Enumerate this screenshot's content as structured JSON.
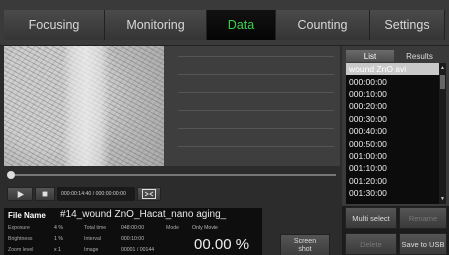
{
  "tabs": [
    "Focusing",
    "Monitoring",
    "Data",
    "Counting",
    "Settings"
  ],
  "player": {
    "timecode": "000:00:14:40 / 000:00:00:00",
    "progress_fraction": 0.0
  },
  "file_info": {
    "file_name_label": "File Name",
    "file_name": "#14_wound ZnO_Hacat_nano aging_",
    "exposure_label": "Exposure",
    "exposure_value": "4 %",
    "brightness_label": "Brightness",
    "brightness_value": "1 %",
    "zoom_label": "Zoom level",
    "zoom_value": "x 1",
    "total_time_label": "Total time",
    "total_time_value": "048:00:00",
    "interval_label": "Interval",
    "interval_value": "000:10:00",
    "image_label": "Image",
    "image_value": "00001 / 00144",
    "mode_label": "Mode",
    "mode_value": "Only Movie",
    "percent": "00.00 %"
  },
  "screenshot_button": {
    "line1": "Screen",
    "line2": "shot"
  },
  "right_panel": {
    "tab_list": "List",
    "tab_results": "Results",
    "items": [
      "wound ZnO avi",
      "000:00:00",
      "000:10:00",
      "000:20:00",
      "000:30:00",
      "000:40:00",
      "000:50:00",
      "001:00:00",
      "001:10:00",
      "001:20:00",
      "001:30:00"
    ],
    "multi_select": "Multi select",
    "rename": "Rename",
    "delete": "Delete",
    "save_usb": "Save to USB"
  },
  "colors": {
    "active_tab_text": "#39d24d",
    "selected_row": "#c9c9c9"
  }
}
